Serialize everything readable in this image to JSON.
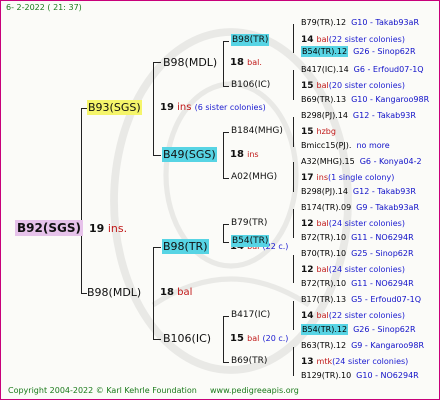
{
  "header": {
    "date": "6-  2-2022 ( 21: 37)"
  },
  "footer": {
    "copyright": "Copyright 2004-2022 © Karl Kehrle Foundation",
    "site": "www.pedigreeapis.org"
  },
  "gen1": {
    "name": "B92(SGS)",
    "num": "19",
    "unit": "ins."
  },
  "gen2": [
    {
      "name": "B93(SGS)",
      "num": "19",
      "unit": "ins",
      "note": "(6 sister colonies)"
    },
    {
      "name": "B98(MDL)",
      "num": "18",
      "unit": "bal"
    }
  ],
  "gen3": [
    {
      "name": "B98(MDL)",
      "num": "18",
      "unit": "bal."
    },
    {
      "name": "B49(SGS)",
      "num": "18",
      "unit": "ins"
    },
    {
      "name": "B98(TR)",
      "num": "14",
      "unit": "bal",
      "note": "(22 c.)"
    },
    {
      "name": "B106(IC)",
      "num": "15",
      "unit": "bal",
      "note": "(20 c.)"
    }
  ],
  "gen4": [
    {
      "name": "B98(TR)"
    },
    {
      "name": "B106(IC)"
    },
    {
      "name": "B184(MHG)"
    },
    {
      "name": "A02(MHG)"
    },
    {
      "name": "B79(TR)"
    },
    {
      "name": "B54(TR)"
    },
    {
      "name": "B417(IC)"
    },
    {
      "name": "B69(TR)"
    }
  ],
  "gen5": [
    {
      "name": "B79(TR).12",
      "code": "G10 - Takab93aR"
    },
    {
      "name": "14",
      "note": "bal",
      "extra": "(22 sister colonies)"
    },
    {
      "name": "B54(TR).12",
      "code": "G26 - Sinop62R"
    },
    {
      "name": "B417(IC).14",
      "code": "G6 - Erfoud07-1Q"
    },
    {
      "name": "15",
      "note": "bal",
      "extra": "(20 sister colonies)"
    },
    {
      "name": "B69(TR).13",
      "code": "G10 - Kangaroo98R"
    },
    {
      "name": "B298(PJ).14",
      "code": "G12 - Takab93R"
    },
    {
      "name": "15",
      "note": "hzbg",
      "extra": ""
    },
    {
      "name": "Bmicc15(PJ).",
      "code": "no more"
    },
    {
      "name": "A32(MHG).15",
      "code": "G6 - Konya04-2"
    },
    {
      "name": "17",
      "note": "ins",
      "extra": "(1 single colony)"
    },
    {
      "name": "B298(PJ).14",
      "code": "G12 - Takab93R"
    },
    {
      "name": "B174(TR).09",
      "code": "G9 - Takab93aR"
    },
    {
      "name": "12",
      "note": "bal",
      "extra": "(24 sister colonies)"
    },
    {
      "name": "B72(TR).10",
      "code": "G11 - NO6294R"
    },
    {
      "name": "B70(TR).10",
      "code": "G25 - Sinop62R"
    },
    {
      "name": "12",
      "note": "bal",
      "extra": "(24 sister colonies)"
    },
    {
      "name": "B72(TR).10",
      "code": "G11 - NO6294R"
    },
    {
      "name": "B17(TR).13",
      "code": "G5 - Erfoud07-1Q"
    },
    {
      "name": "14",
      "note": "bal",
      "extra": "(22 sister colonies)"
    },
    {
      "name": "B54(TR).12",
      "code": "G26 - Sinop62R"
    },
    {
      "name": "B63(TR).12",
      "code": "G9 - Kangaroo98R"
    },
    {
      "name": "13",
      "note": "mtk",
      "extra": "(24 sister colonies)"
    },
    {
      "name": "B129(TR).10",
      "code": "G10 - NO6294R"
    }
  ],
  "colors": {
    "border": "#c8007a",
    "yellow_highlight": "#f5f56a",
    "cyan_highlight": "#57d4e4",
    "pink_highlight": "#e6c2ea",
    "red_text": "#c01818",
    "code_text": "#1010c8",
    "header_text": "#1a7a1a"
  }
}
